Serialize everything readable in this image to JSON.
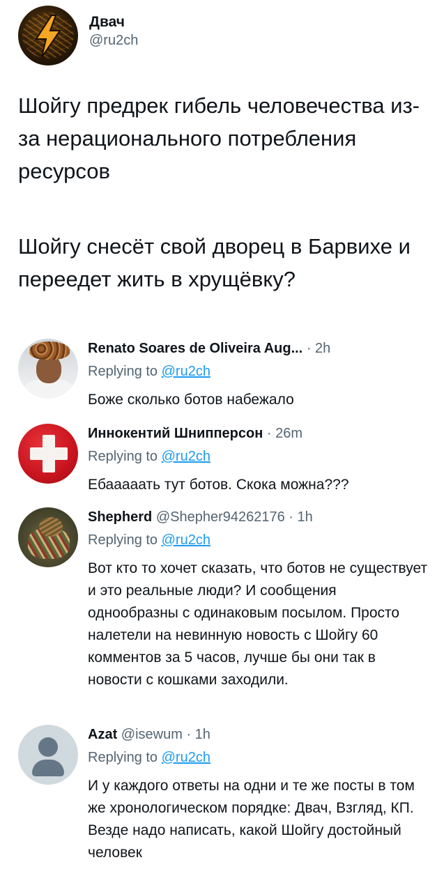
{
  "author": {
    "name": "Двач",
    "handle": "@ru2ch",
    "avatar_icon": "lightning-bolt-icon"
  },
  "tweet": {
    "paragraphs": [
      "Шойгу предрек гибель человечества из-за нерационального потребления ресурсов",
      "Шойгу снесёт свой дворец в Барвихе и переедет жить в хрущёвку?"
    ]
  },
  "replies": [
    {
      "name": "Renato Soares de Oliveira Aug...",
      "handle": "",
      "time": "· 2h",
      "replying_prefix": "Replying to ",
      "replying_handle": "@ru2ch",
      "text": "Боже сколько ботов набежало"
    },
    {
      "name": "Иннокентий Шнипперсон",
      "handle": "",
      "time": "· 26m",
      "replying_prefix": "Replying to ",
      "replying_handle": "@ru2ch",
      "text": "Ебааааать тут ботов. Скока можна???"
    },
    {
      "name": "Shepherd",
      "handle": "@Shepher94262176",
      "time": "· 1h",
      "replying_prefix": "Replying to ",
      "replying_handle": "@ru2ch",
      "text": "Вот кто то хочет сказать, что ботов не существует и это реальные люди? И сообщения однообразны с одинаковым посылом. Просто налетели на невинную новость с Шойгу 60 комментов за 5 часов, лучше бы они так в новости с кошками заходили."
    },
    {
      "name": "Azat",
      "handle": "@isewum",
      "time": "· 1h",
      "replying_prefix": "Replying to ",
      "replying_handle": "@ru2ch",
      "text": "И у каждого ответы на одни и те же посты в том же хронологическом порядке: Двач, Взгляд, КП. Везде надо написать, какой Шойгу достойный человек"
    }
  ],
  "colors": {
    "link": "#1d9bf0",
    "secondary_text": "#536471",
    "primary_text": "#0f1419",
    "bolt": "#f5a623"
  }
}
